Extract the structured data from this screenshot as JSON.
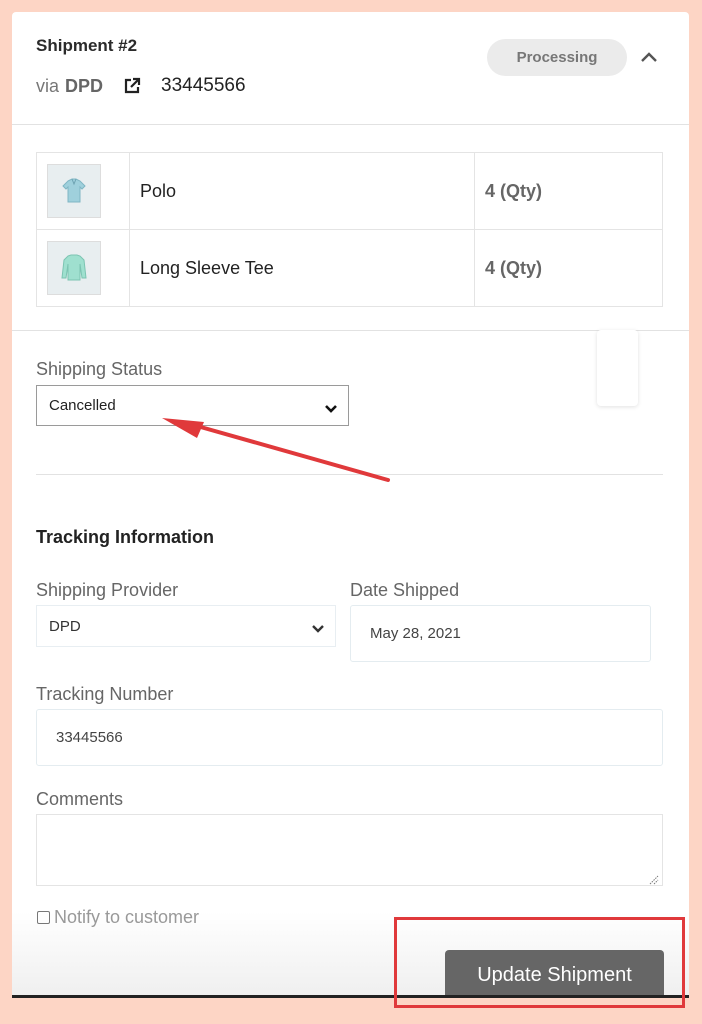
{
  "header": {
    "title": "Shipment #2",
    "via_prefix": "via",
    "carrier": "DPD",
    "tracking_number": "33445566",
    "status_badge": "Processing"
  },
  "items": [
    {
      "name": "Polo",
      "qty": "4 (Qty)",
      "thumb_icon": "polo-shirt-icon",
      "thumb_color": "#9fd0dc"
    },
    {
      "name": "Long Sleeve Tee",
      "qty": "4 (Qty)",
      "thumb_icon": "long-sleeve-tee-icon",
      "thumb_color": "#9fe0cf"
    }
  ],
  "shipping_status": {
    "label": "Shipping Status",
    "selected": "Cancelled"
  },
  "tracking": {
    "section_title": "Tracking Information",
    "provider_label": "Shipping Provider",
    "provider_selected": "DPD",
    "date_label": "Date Shipped",
    "date_value": "May 28, 2021",
    "number_label": "Tracking Number",
    "number_value": "33445566",
    "comments_label": "Comments",
    "comments_value": ""
  },
  "notify": {
    "label": "Notify to customer",
    "checked": false
  },
  "actions": {
    "update_label": "Update Shipment"
  },
  "annotations": {
    "color": "#e0393b"
  }
}
